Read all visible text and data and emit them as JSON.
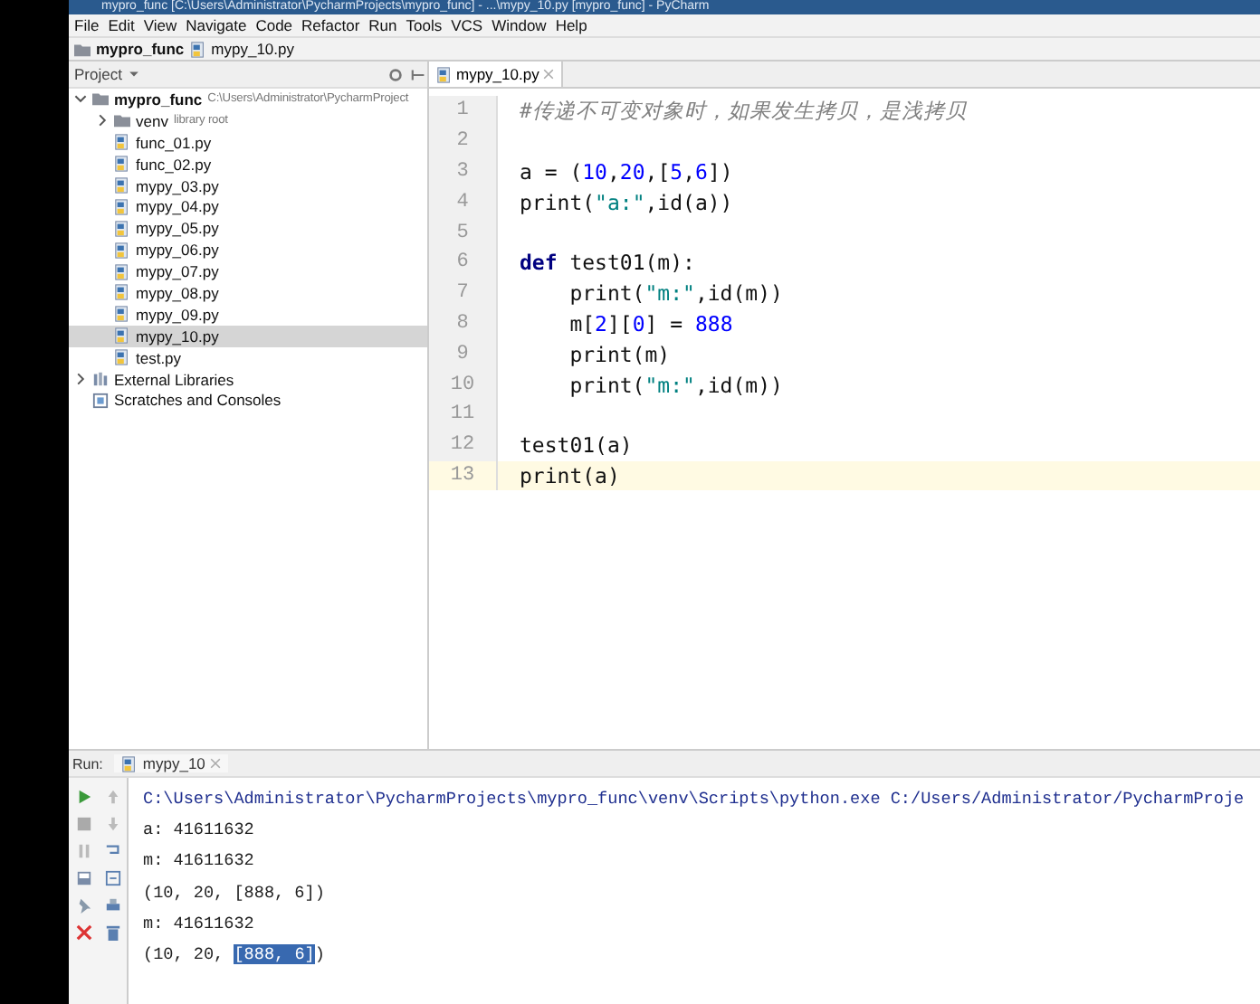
{
  "window": {
    "title": "mypro_func [C:\\Users\\Administrator\\PycharmProjects\\mypro_func] - ...\\mypy_10.py [mypro_func] - PyCharm"
  },
  "menu": [
    "File",
    "Edit",
    "View",
    "Navigate",
    "Code",
    "Refactor",
    "Run",
    "Tools",
    "VCS",
    "Window",
    "Help"
  ],
  "breadcrumb": [
    "mypro_func",
    "mypy_10.py"
  ],
  "project_panel": {
    "title": "Project",
    "tree": [
      {
        "label": "mypro_func",
        "note": "C:\\Users\\Administrator\\PycharmProject",
        "kind": "folder",
        "expanded": true,
        "selected": false,
        "children": [
          {
            "label": "venv",
            "note": "library root",
            "kind": "folder",
            "expanded": false,
            "selected": false
          },
          {
            "label": "func_01.py",
            "kind": "file",
            "selected": false
          },
          {
            "label": "func_02.py",
            "kind": "file",
            "selected": false
          },
          {
            "label": "mypy_03.py",
            "kind": "file",
            "selected": false
          },
          {
            "label": "mypy_04.py",
            "kind": "file",
            "selected": false
          },
          {
            "label": "mypy_05.py",
            "kind": "file",
            "selected": false
          },
          {
            "label": "mypy_06.py",
            "kind": "file",
            "selected": false
          },
          {
            "label": "mypy_07.py",
            "kind": "file",
            "selected": false
          },
          {
            "label": "mypy_08.py",
            "kind": "file",
            "selected": false
          },
          {
            "label": "mypy_09.py",
            "kind": "file",
            "selected": false
          },
          {
            "label": "mypy_10.py",
            "kind": "file",
            "selected": true
          },
          {
            "label": "test.py",
            "kind": "file",
            "selected": false
          }
        ]
      },
      {
        "label": "External Libraries",
        "kind": "library",
        "expanded": false,
        "selected": false
      },
      {
        "label": "Scratches and Consoles",
        "kind": "scratch",
        "selected": false
      }
    ]
  },
  "editor": {
    "tab": "mypy_10.py",
    "lines": [
      {
        "number": "1",
        "current": false,
        "tokens": [
          {
            "text": "#传递不可变对象时，如果发生拷贝，是浅拷贝",
            "kind": "comment"
          }
        ]
      },
      {
        "number": "2",
        "current": false
      },
      {
        "number": "3",
        "current": false,
        "tokens": [
          {
            "text": "a = (",
            "kind": "plain"
          },
          {
            "text": "10",
            "kind": "number"
          },
          {
            "text": ",",
            "kind": "plain"
          },
          {
            "text": "20",
            "kind": "number"
          },
          {
            "text": ",[",
            "kind": "plain"
          },
          {
            "text": "5",
            "kind": "number"
          },
          {
            "text": ",",
            "kind": "plain"
          },
          {
            "text": "6",
            "kind": "number"
          },
          {
            "text": "])",
            "kind": "plain"
          }
        ]
      },
      {
        "number": "4",
        "current": false,
        "tokens": [
          {
            "text": "print(",
            "kind": "plain"
          },
          {
            "text": "\"a:\"",
            "kind": "string"
          },
          {
            "text": ",id(a))",
            "kind": "plain"
          }
        ]
      },
      {
        "number": "5",
        "current": false
      },
      {
        "number": "6",
        "current": false,
        "tokens": [
          {
            "text": "def",
            "kind": "keyword"
          },
          {
            "text": " test01(m):",
            "kind": "plain"
          }
        ]
      },
      {
        "number": "7",
        "current": false,
        "tokens": [
          {
            "text": "    print(",
            "kind": "plain"
          },
          {
            "text": "\"m:\"",
            "kind": "string"
          },
          {
            "text": ",id(m))",
            "kind": "plain"
          }
        ]
      },
      {
        "number": "8",
        "current": false,
        "tokens": [
          {
            "text": "    m[",
            "kind": "plain"
          },
          {
            "text": "2",
            "kind": "number"
          },
          {
            "text": "][",
            "kind": "plain"
          },
          {
            "text": "0",
            "kind": "number"
          },
          {
            "text": "] = ",
            "kind": "plain"
          },
          {
            "text": "888",
            "kind": "number"
          }
        ]
      },
      {
        "number": "9",
        "current": false,
        "tokens": [
          {
            "text": "    print(m)",
            "kind": "plain"
          }
        ]
      },
      {
        "number": "10",
        "current": false,
        "tokens": [
          {
            "text": "    print(",
            "kind": "plain"
          },
          {
            "text": "\"m:\"",
            "kind": "string"
          },
          {
            "text": ",id(m))",
            "kind": "plain"
          }
        ]
      },
      {
        "number": "11",
        "current": false
      },
      {
        "number": "12",
        "current": false,
        "tokens": [
          {
            "text": "test01(a)",
            "kind": "plain"
          }
        ]
      },
      {
        "number": "13",
        "current": true,
        "tokens": [
          {
            "text": "print(a)",
            "kind": "plain"
          }
        ]
      }
    ]
  },
  "run_panel": {
    "label": "Run:",
    "tab": "mypy_10",
    "console": [
      {
        "kind": "command",
        "segments": [
          {
            "text": "C:\\Users\\Administrator\\PycharmProjects\\mypro_func\\venv\\Scripts\\python.exe C:/Users/Administrator/PycharmProje",
            "selected": false
          }
        ]
      },
      {
        "kind": "output",
        "segments": [
          {
            "text": "a: 41611632",
            "selected": false
          }
        ]
      },
      {
        "kind": "output",
        "segments": [
          {
            "text": "m: 41611632",
            "selected": false
          }
        ]
      },
      {
        "kind": "output",
        "segments": [
          {
            "text": "(10, 20, [888, 6])",
            "selected": false
          }
        ]
      },
      {
        "kind": "output",
        "segments": [
          {
            "text": "m: 41611632",
            "selected": false
          }
        ]
      },
      {
        "kind": "output",
        "segments": [
          {
            "text": "(10, 20, ",
            "selected": false
          },
          {
            "text": "[888, 6]",
            "selected": true
          },
          {
            "text": ")",
            "selected": false
          }
        ]
      }
    ]
  }
}
